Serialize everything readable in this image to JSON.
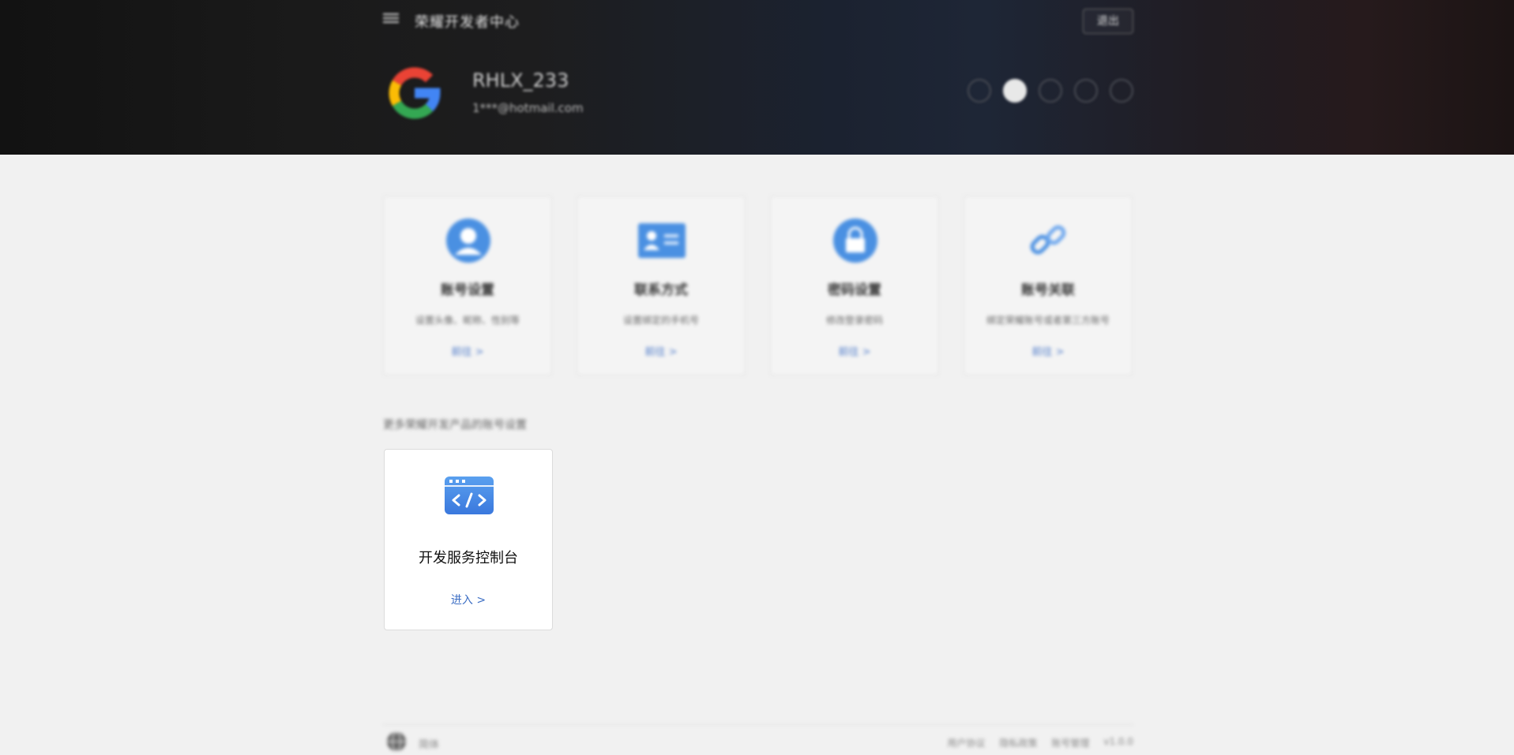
{
  "header": {
    "app_title": "荣耀开发者中心",
    "logout_label": "退出",
    "user": {
      "name": "RHLX_233",
      "email": "1***@hotmail.com"
    },
    "theme_dot_count": 5,
    "active_theme_index": 1
  },
  "cards": [
    {
      "icon": "user-icon",
      "title": "账号设置",
      "desc": "设置头像、昵称、性别等",
      "link": "前往 >"
    },
    {
      "icon": "id-card-icon",
      "title": "联系方式",
      "desc": "设置绑定的手机号",
      "link": "前往 >"
    },
    {
      "icon": "lock-icon",
      "title": "密码设置",
      "desc": "修改登录密码",
      "link": "前往 >"
    },
    {
      "icon": "link-icon",
      "title": "账号关联",
      "desc": "绑定荣耀账号或者第三方账号",
      "link": "前往 >"
    }
  ],
  "section_label": "更多荣耀开发产品的账号设置",
  "dev_card": {
    "icon": "code-window-icon",
    "title": "开发服务控制台",
    "link": "进入 >"
  },
  "footer": {
    "language": "简体",
    "links": [
      "用户协议",
      "隐私政策",
      "账号管理",
      "v1.0.0"
    ]
  },
  "colors": {
    "accent": "#3c6ec4",
    "icon_blue": "#4a90e2",
    "background": "#f1f1f1"
  }
}
